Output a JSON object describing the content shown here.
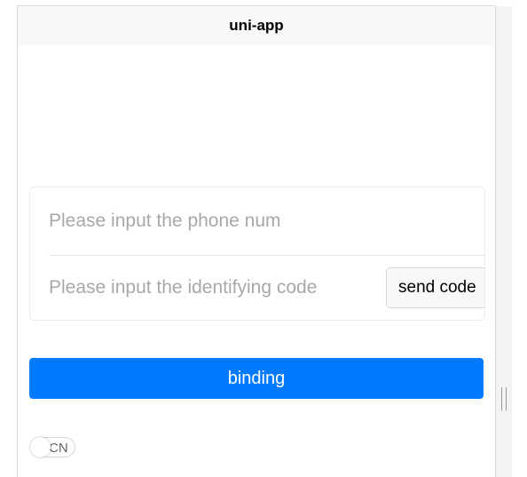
{
  "navbar": {
    "title": "uni-app"
  },
  "form": {
    "phone_placeholder": "Please input the phone num",
    "code_placeholder": "Please input the identifying code",
    "send_code_label": "send code"
  },
  "actions": {
    "binding_label": "binding"
  },
  "language_switch": {
    "label": "CN"
  },
  "colors": {
    "primary": "#007aff",
    "navbar_bg": "#f8f8f8",
    "placeholder": "#a8a8a8"
  }
}
